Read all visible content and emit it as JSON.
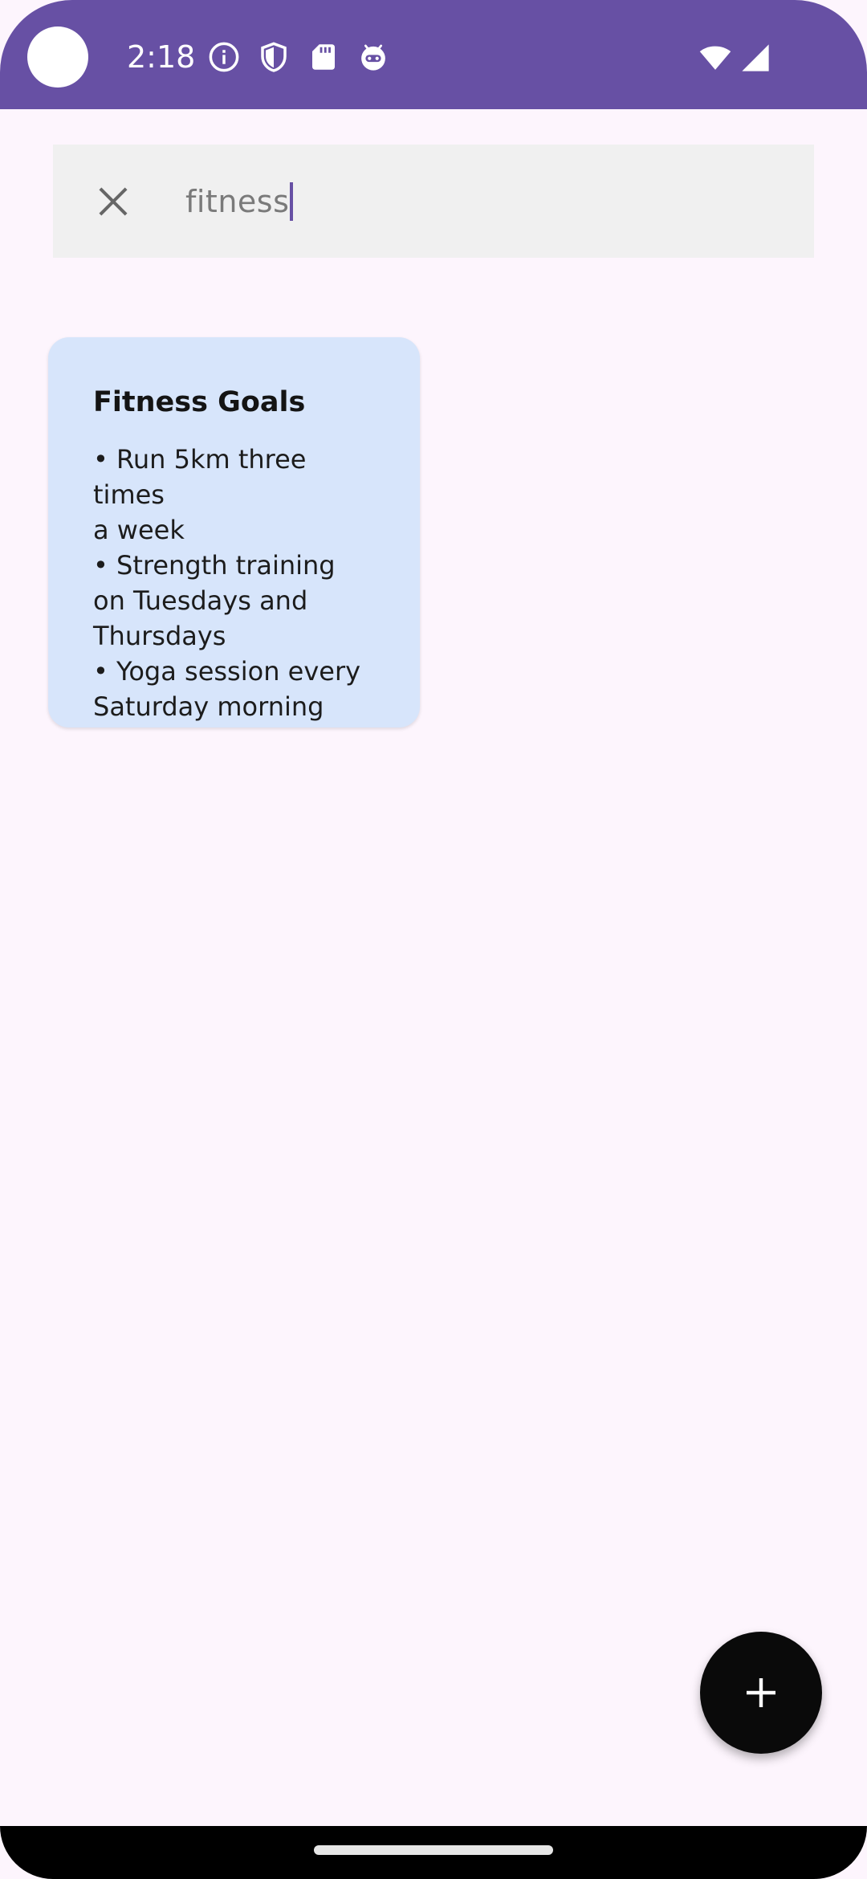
{
  "status_bar": {
    "time": "2:18",
    "background_color": "#6750a4",
    "left_icons": [
      "info-icon",
      "shield-icon",
      "sd-card-icon",
      "android-face-icon"
    ],
    "right_icons": [
      "wifi-icon",
      "cellular-signal-icon"
    ]
  },
  "search": {
    "query": "fitness",
    "close_icon": "close-icon"
  },
  "notes": [
    {
      "title": "Fitness Goals",
      "lines": [
        "• Run 5km three times",
        "a week",
        "• Strength training",
        "on Tuesdays and",
        "Thursdays",
        "• Yoga session every",
        "Saturday morning"
      ],
      "background_color": "#d7e5fb"
    }
  ],
  "fab": {
    "icon": "plus-icon",
    "background_color": "#0a0a0a"
  },
  "navigation": {
    "handle": "home-gesture-handle"
  }
}
